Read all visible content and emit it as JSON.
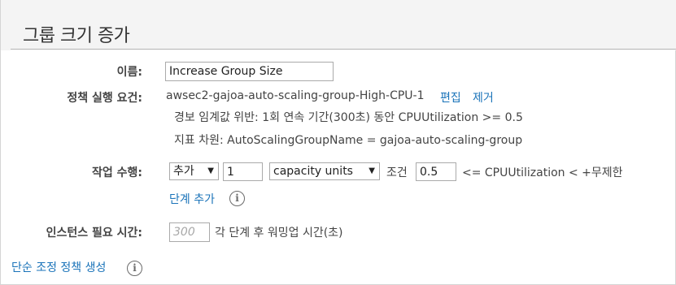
{
  "header": {
    "title": "그룹 크기 증가"
  },
  "form": {
    "name_label": "이름:",
    "name_value": "Increase Group Size",
    "policy_label": "정책 실행 요건:",
    "alarm_name": "awsec2-gajoa-auto-scaling-group-High-CPU-1",
    "edit_link": "편집",
    "remove_link": "제거",
    "alarm_breach": "경보 임계값 위반: 1회 연속 기간(300초) 동안 CPUUtilization >= 0.5",
    "alarm_dimension": "지표 차원: AutoScalingGroupName = gajoa-auto-scaling-group",
    "action_label": "작업 수행:",
    "action_select": "추가",
    "action_amount": "1",
    "unit_select": "capacity units",
    "condition_label": "조건",
    "condition_value": "0.5",
    "condition_suffix": "<= CPUUtilization < +무제한",
    "add_step_link": "단계 추가",
    "warmup_label": "인스턴스 필요 시간:",
    "warmup_placeholder": "300",
    "warmup_suffix": "각 단계 후 워밍업 시간(초)"
  },
  "footer": {
    "simple_policy_link": "단순 조정 정책 생성"
  },
  "icons": {
    "info": "info-icon",
    "dropdown": "chevron-down-icon"
  },
  "colors": {
    "link": "#1a73b9",
    "label": "#444444",
    "header_bg": "#f4f4f4"
  }
}
